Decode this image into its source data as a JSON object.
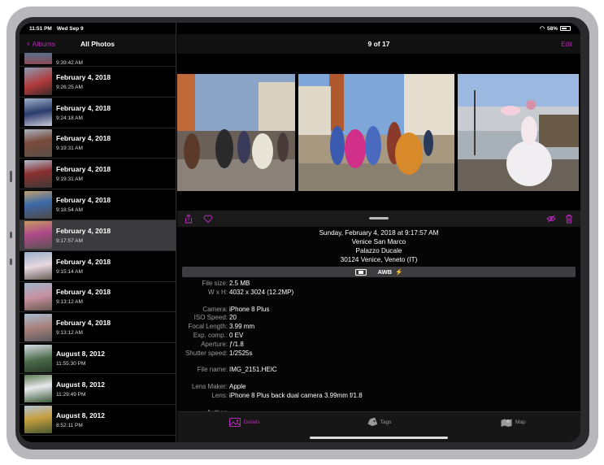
{
  "status": {
    "time": "11:51 PM",
    "date": "Wed Sep 9",
    "battery": "58%"
  },
  "sidebar": {
    "back_label": "Albums",
    "title": "All Photos",
    "partial_time": "9:39:42 AM",
    "partial_date": "February 4, 2018",
    "items": [
      {
        "date": "February 4, 2018",
        "time": "9:26:25 AM"
      },
      {
        "date": "February 4, 2018",
        "time": "9:24:18 AM"
      },
      {
        "date": "February 4, 2018",
        "time": "9:19:31 AM"
      },
      {
        "date": "February 4, 2018",
        "time": "9:19:31 AM"
      },
      {
        "date": "February 4, 2018",
        "time": "9:18:54 AM"
      },
      {
        "date": "February 4, 2018",
        "time": "9:17:57 AM"
      },
      {
        "date": "February 4, 2018",
        "time": "9:15:14 AM"
      },
      {
        "date": "February 4, 2018",
        "time": "9:13:12 AM"
      },
      {
        "date": "February 4, 2018",
        "time": "9:13:12 AM"
      },
      {
        "date": "August 8, 2012",
        "time": "11:55:30 PM"
      },
      {
        "date": "August 8, 2012",
        "time": "11:29:49 PM"
      },
      {
        "date": "August 8, 2012",
        "time": "8:52:11 PM"
      }
    ]
  },
  "main": {
    "counter": "9 of 17",
    "edit_label": "Edit",
    "address": [
      "Sunday, February 4, 2018 at 9:17:57 AM",
      "Venice San Marco",
      "Palazzo Ducale",
      "30124 Venice, Veneto (IT)"
    ],
    "exif_bar": {
      "awb": "AWB"
    },
    "details": [
      {
        "label": "File size:",
        "value": "2.5 MB"
      },
      {
        "label": "W x H:",
        "value": "4032 x 3024 (12.2MP)"
      },
      {
        "label": "Camera:",
        "value": "iPhone 8 Plus"
      },
      {
        "label": "ISO Speed:",
        "value": "20"
      },
      {
        "label": "Focal Length:",
        "value": "3.99 mm"
      },
      {
        "label": "Exp. comp.:",
        "value": "0 EV"
      },
      {
        "label": "Aperture:",
        "value": "ƒ/1.8"
      },
      {
        "label": "Shutter speed:",
        "value": "1/2525s"
      },
      {
        "label": "File name:",
        "value": "IMG_2151.HEIC"
      },
      {
        "label": "Lens Maker:",
        "value": "Apple"
      },
      {
        "label": "Lens:",
        "value": "iPhone 8 Plus back dual camera 3.99mm f/1.8"
      },
      {
        "label": "Author:",
        "value": "--"
      }
    ]
  },
  "tabs": [
    {
      "label": "Details",
      "icon": "photo-details-icon"
    },
    {
      "label": "Tags",
      "icon": "tag-icon"
    },
    {
      "label": "Map",
      "icon": "map-icon"
    }
  ],
  "colors": {
    "accent": "#b52ab7",
    "background": "#000000",
    "selected_row": "#3b3b3d"
  }
}
